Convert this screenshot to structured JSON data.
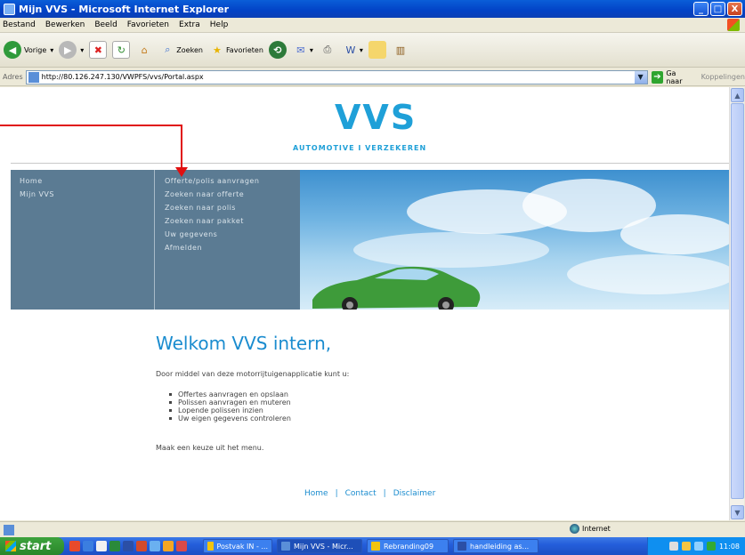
{
  "window": {
    "title": "Mijn VVS - Microsoft Internet Explorer",
    "buttons": [
      "_",
      "□",
      "X"
    ]
  },
  "menubar": [
    "Bestand",
    "Bewerken",
    "Beeld",
    "Favorieten",
    "Extra",
    "Help"
  ],
  "toolbar": {
    "back": "Vorige",
    "search": "Zoeken",
    "favorites": "Favorieten"
  },
  "address": {
    "label": "Adres",
    "url": "http://80.126.247.130/VWPFS/vvs/Portal.aspx",
    "go": "Ga naar",
    "links": "Koppelingen"
  },
  "page": {
    "logo": "VVS",
    "tagline": "AUTOMOTIVE I VERZEKEREN",
    "nav_left": [
      "Home",
      "Mijn VVS"
    ],
    "nav_right": [
      "Offerte/polis aanvragen",
      "Zoeken naar offerte",
      "Zoeken naar polis",
      "Zoeken naar pakket",
      "Uw gegevens",
      "Afmelden"
    ],
    "welcome": "Welkom VVS intern,",
    "intro": "Door middel van deze motorrijtuigenapplicatie kunt u:",
    "bullets": [
      "Offertes aanvragen en opslaan",
      "Polissen aanvragen en muteren",
      "Lopende polissen inzien",
      "Uw eigen gegevens controleren"
    ],
    "outro": "Maak een keuze uit het menu.",
    "footer": [
      "Home",
      "Contact",
      "Disclaimer"
    ],
    "footer_sep": "|"
  },
  "statusbar": {
    "zone": "Internet"
  },
  "taskbar": {
    "start": "start",
    "tasks": [
      "Postvak IN - ...",
      "Mijn VVS - Micr...",
      "Rebranding09",
      "handleiding as..."
    ],
    "clock": "11:08"
  },
  "colors": {
    "brand": "#1fa0d8",
    "nav_bg": "#5b7b93",
    "annotation": "#e01010"
  }
}
